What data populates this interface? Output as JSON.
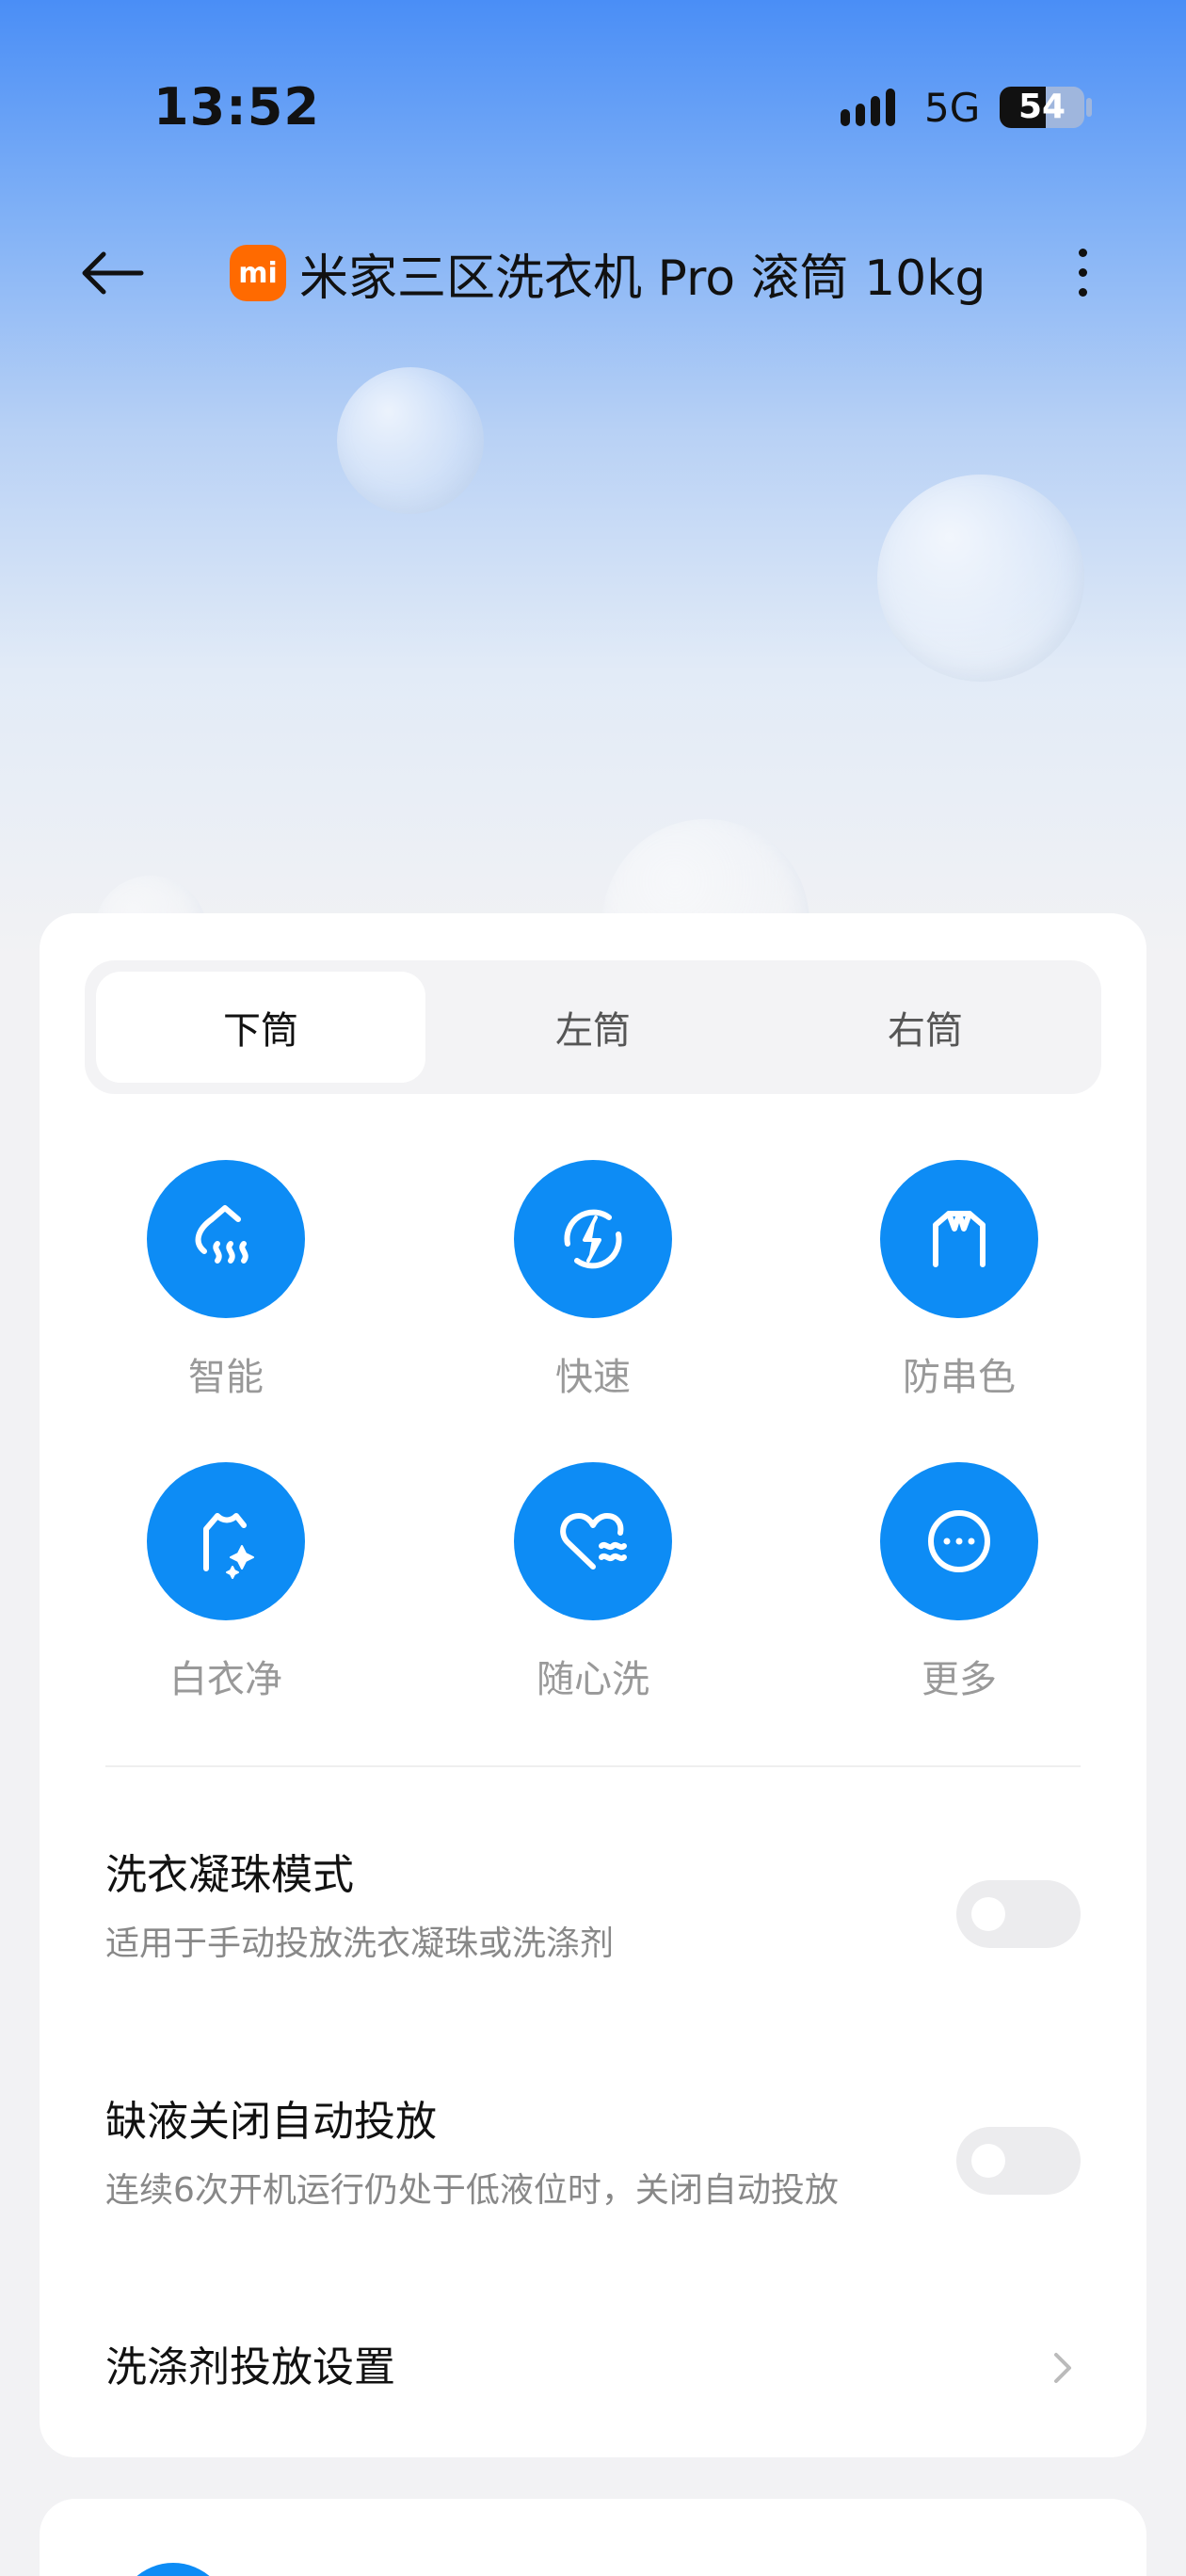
{
  "status_bar": {
    "time": "13:52",
    "network": "5G",
    "battery_percent": "54",
    "battery_level": 0.54
  },
  "header": {
    "logo_text": "mi",
    "title": "米家三区洗衣机 Pro 滚筒 10kg"
  },
  "tabs": [
    {
      "label": "下筒",
      "active": true
    },
    {
      "label": "左筒",
      "active": false
    },
    {
      "label": "右筒",
      "active": false
    }
  ],
  "modes": [
    {
      "label": "智能",
      "icon": "smart-wash-icon"
    },
    {
      "label": "快速",
      "icon": "quick-wash-icon"
    },
    {
      "label": "防串色",
      "icon": "anti-color-bleed-icon"
    },
    {
      "label": "白衣净",
      "icon": "white-clothes-icon"
    },
    {
      "label": "随心洗",
      "icon": "custom-wash-icon"
    },
    {
      "label": "更多",
      "icon": "more-modes-icon"
    }
  ],
  "settings": {
    "pod_mode": {
      "title": "洗衣凝珠模式",
      "subtitle": "适用于手动投放洗衣凝珠或洗涤剂",
      "enabled": false
    },
    "low_liquid": {
      "title": "缺液关闭自动投放",
      "subtitle": "连续6次开机运行仍处于低液位时，关闭自动投放",
      "enabled": false
    },
    "detergent": {
      "title": "洗涤剂投放设置"
    }
  },
  "colors": {
    "accent": "#0d8cf5",
    "logo": "#ff6a00"
  }
}
